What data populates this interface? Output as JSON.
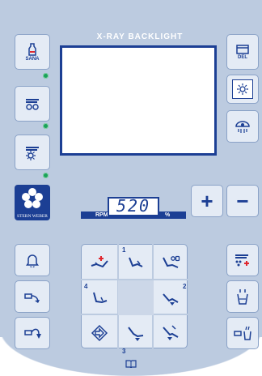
{
  "header": {
    "title": "X-RAY BACKLIGHT"
  },
  "left_buttons": {
    "sana_label": "SANA"
  },
  "right_buttons": {
    "del_label": "DEL"
  },
  "brand": {
    "name": "STERN WEBER"
  },
  "rpm": {
    "label": "RPM",
    "value": "520",
    "unit": "%"
  },
  "controls": {
    "plus": "+",
    "minus": "−"
  },
  "chair_positions": {
    "n1": "1",
    "n2": "2",
    "n3": "3",
    "n4": "4"
  },
  "colors": {
    "panel": "#bccbe0",
    "accent": "#1c3f94",
    "button": "#e4ebf5",
    "led": "#1aa35a",
    "alert": "#e0262e"
  },
  "icons": [
    "sana-bottle-icon",
    "instrument-rotate-icon",
    "instrument-light-icon",
    "brand-logo",
    "del-icon",
    "backlight-icon",
    "operating-lamp-icon",
    "bell-icon",
    "spittoon-left-icon",
    "spittoon-down-icon",
    "chair-add-icon",
    "chair-position-1-icon",
    "chair-seat-icon",
    "chair-position-4-icon",
    "chair-position-2-icon",
    "chair-exit-icon",
    "chair-position-3-icon",
    "chair-backrest-icon",
    "instrument-settings-icon",
    "cup-fill-icon",
    "bowl-rinse-icon",
    "book-icon"
  ]
}
